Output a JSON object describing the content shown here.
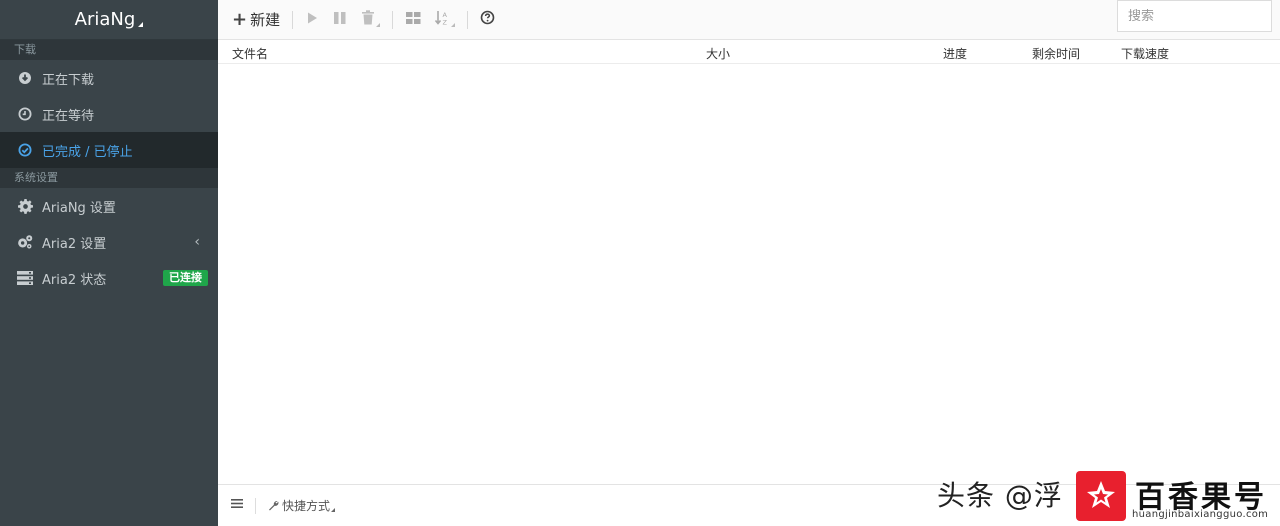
{
  "brand": {
    "title": "AriaNg"
  },
  "sidebar": {
    "sections": [
      {
        "header": "下载"
      },
      {
        "header": "系统设置"
      }
    ],
    "download_items": [
      {
        "label": "正在下载",
        "icon": "download-circle-icon"
      },
      {
        "label": "正在等待",
        "icon": "clock-icon"
      },
      {
        "label": "已完成 / 已停止",
        "icon": "check-circle-icon",
        "active": true
      }
    ],
    "settings_items": [
      {
        "label": "AriaNg 设置",
        "icon": "gear-icon"
      },
      {
        "label": "Aria2 设置",
        "icon": "gears-icon",
        "chevron": "‹"
      },
      {
        "label": "Aria2 状态",
        "icon": "server-icon",
        "badge": "已连接"
      }
    ]
  },
  "toolbar": {
    "new_label": "新建",
    "search_placeholder": "搜索"
  },
  "table": {
    "columns": [
      "文件名",
      "大小",
      "进度",
      "剩余时间",
      "下载速度"
    ]
  },
  "footer": {
    "shortcut_label": "快捷方式"
  },
  "watermark": {
    "text": "头条 @浮",
    "brand": "百香果号",
    "url": "huangjinbaixiangguo.com"
  },
  "colors": {
    "sidebar_bg": "#3a4449",
    "active_bg": "#22292c",
    "active_text": "#4aa3e8",
    "badge_bg": "#1fa64a",
    "logo_red": "#e8202e"
  }
}
